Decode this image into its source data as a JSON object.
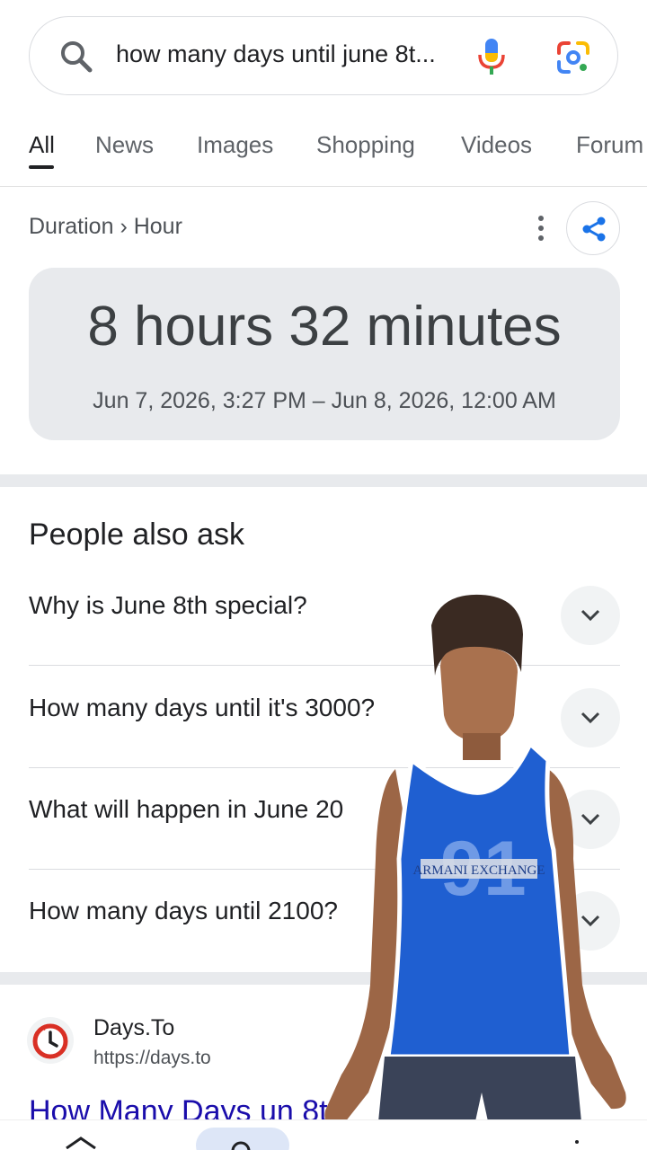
{
  "search": {
    "query": "how many days until june 8t..."
  },
  "tabs": [
    {
      "label": "All",
      "active": true
    },
    {
      "label": "News"
    },
    {
      "label": "Images"
    },
    {
      "label": "Shopping"
    },
    {
      "label": "Videos"
    },
    {
      "label": "Forum"
    }
  ],
  "result": {
    "breadcrumb": "Duration › Hour",
    "duration": "8 hours 32 minutes",
    "range": "Jun 7, 2026, 3:27 PM – Jun 8, 2026, 12:00 AM"
  },
  "people_also_ask": {
    "title": "People also ask",
    "questions": [
      "Why is June 8th special?",
      "How many days until it's 3000?",
      "What will happen in June 20",
      "How many days until 2100?"
    ]
  },
  "web_result": {
    "site_name": "Days.To",
    "url": "https://days.to",
    "title": "How Many Days un    8t"
  },
  "overlay": {
    "jersey_text": "ARMANI EXCHANGE",
    "jersey_number": "91"
  },
  "colors": {
    "accent": "#1a73e8",
    "card": "#e8eaed",
    "link": "#1a0dab",
    "jersey": "#1f5fd1"
  }
}
